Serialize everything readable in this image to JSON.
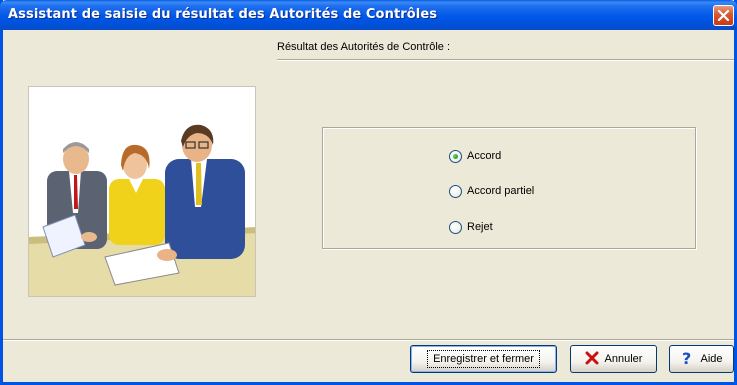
{
  "window": {
    "title": "Assistant de saisie du résultat des Autorités de Contrôles",
    "close_icon": "close-icon"
  },
  "header": {
    "label": "Résultat des Autorités de Contrôle :"
  },
  "options": [
    {
      "label": "Accord",
      "checked": true
    },
    {
      "label": "Accord partiel",
      "checked": false
    },
    {
      "label": "Rejet",
      "checked": false
    }
  ],
  "buttons": {
    "save": "Enregistrer et fermer",
    "cancel": "Annuler",
    "help": "Aide"
  },
  "icons": {
    "cancel": "red-x-icon",
    "help": "question-mark-icon"
  },
  "colors": {
    "titlebar": "#0058e8",
    "dialog_bg": "#ece9d8",
    "cancel_icon": "#cc1010",
    "help_icon": "#1a4fc4"
  }
}
